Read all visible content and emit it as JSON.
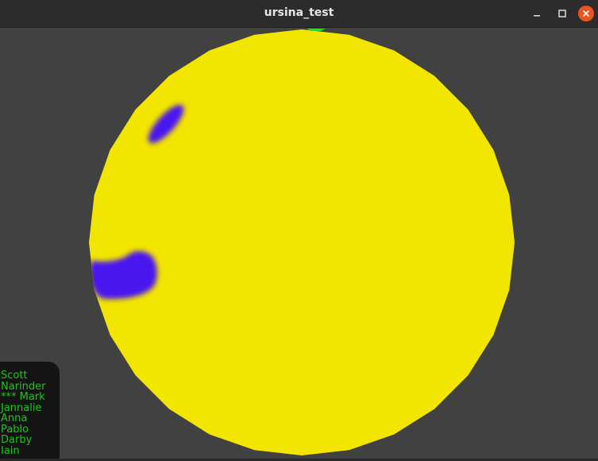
{
  "window": {
    "title": "ursina_test",
    "controls": {
      "minimize_icon": "minimize-icon",
      "maximize_icon": "maximize-icon",
      "close_icon": "close-icon"
    }
  },
  "scene": {
    "background_color": "#414141",
    "sphere_color": "#f2e500",
    "spot_color": "#4a12f0",
    "top_marker_color": "#3ccf3c"
  },
  "name_list": {
    "text_color": "#22c322",
    "background_color": "#141414",
    "items": [
      "Scott",
      "Narinder",
      "*** Mark",
      "Jannalie",
      "Anna",
      "Pablo",
      "Darby",
      "Iain"
    ]
  }
}
